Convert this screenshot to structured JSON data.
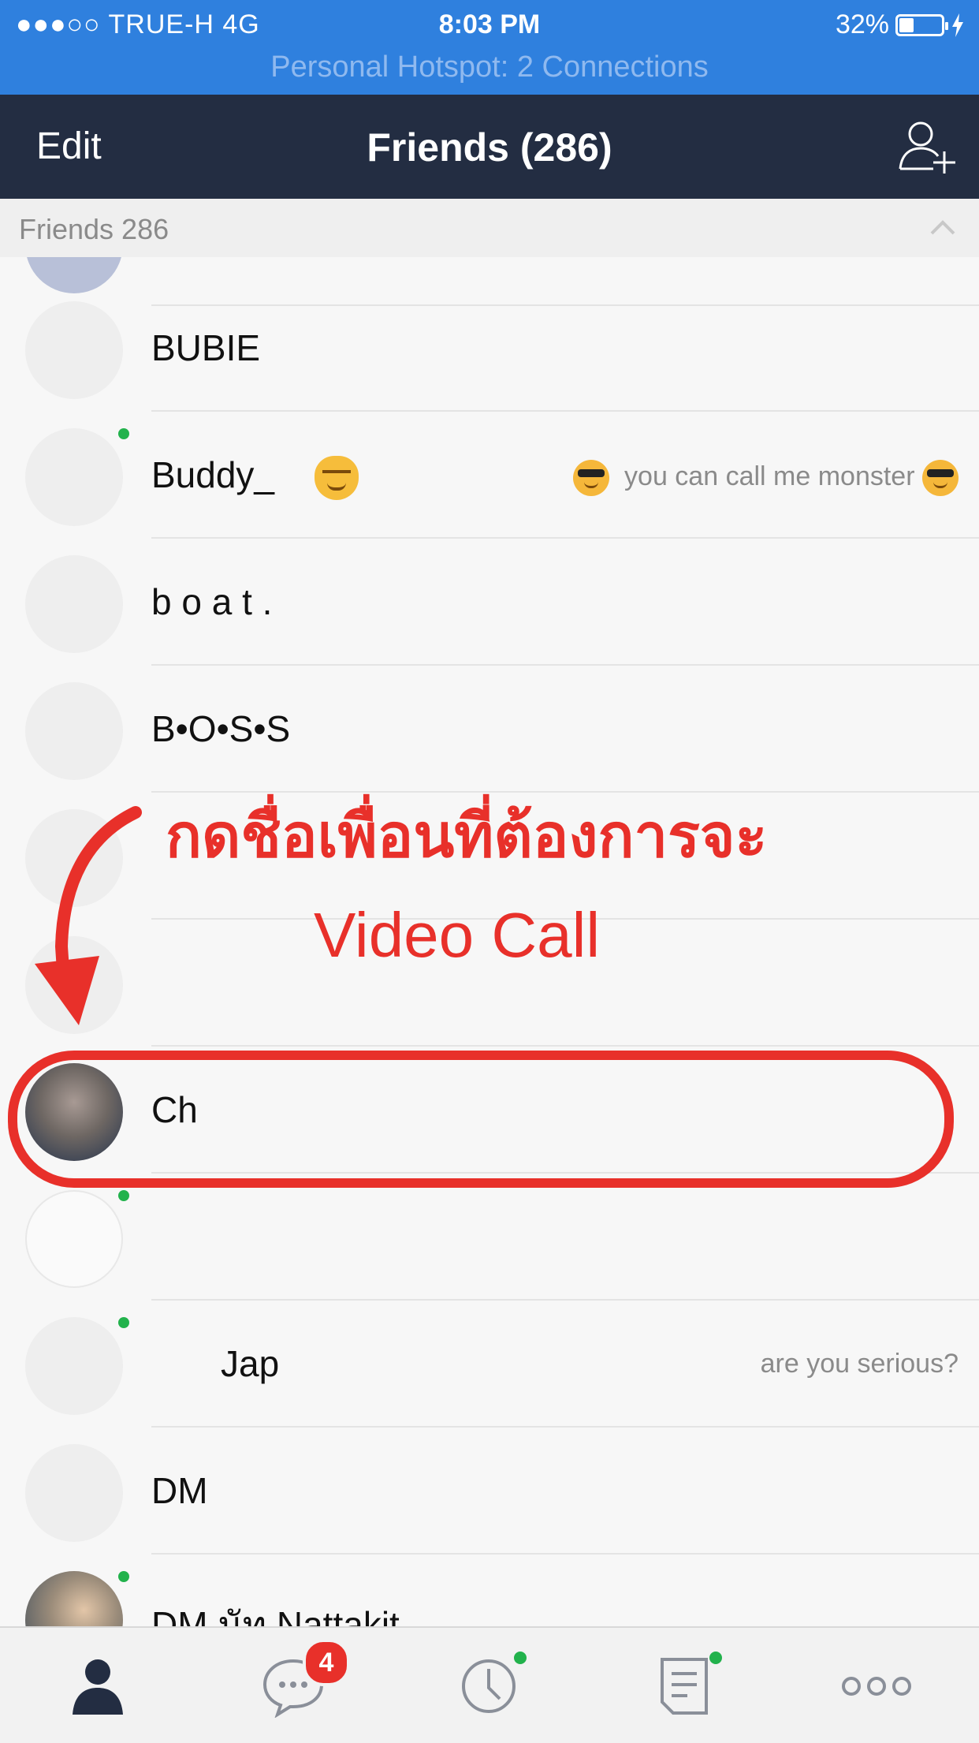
{
  "status_bar": {
    "carrier": "●●●○○ TRUE-H   4G",
    "time": "8:03 PM",
    "battery": "32%",
    "hotspot": "Personal Hotspot: 2 Connections"
  },
  "nav": {
    "edit_label": "Edit",
    "title": "Friends (286)",
    "add_icon": "add-friend-icon"
  },
  "section": {
    "label": "Friends 286",
    "collapse_icon": "chevron-up-icon"
  },
  "friends": [
    {
      "name": "BUBIE",
      "status": "",
      "online": false
    },
    {
      "name": "Buddy_",
      "status": "you can call me monster",
      "online": true
    },
    {
      "name": "b o a t .",
      "status": "",
      "online": false
    },
    {
      "name": "B•O•S•S",
      "status": "",
      "online": false
    },
    {
      "name": "Ch",
      "status": "",
      "online": false
    },
    {
      "name": "Jap",
      "status": "are you serious?",
      "online": true
    },
    {
      "name": "DM",
      "status": "",
      "online": false
    },
    {
      "name": "DM นัท Nattakit",
      "status": "",
      "online": true
    }
  ],
  "annotation": {
    "line1": "กดชื่อเพื่อนที่ต้องการจะ",
    "line2": "Video Call",
    "color": "#e8302a"
  },
  "tabbar": {
    "tabs": [
      {
        "icon": "friends-icon"
      },
      {
        "icon": "chats-icon",
        "badge": "4"
      },
      {
        "icon": "timeline-icon"
      },
      {
        "icon": "news-icon"
      },
      {
        "icon": "more-icon"
      }
    ]
  },
  "colors": {
    "status_bar": "#2f80de",
    "nav_bar": "#232d42",
    "online_dot": "#22b24c",
    "badge": "#e8302a"
  }
}
